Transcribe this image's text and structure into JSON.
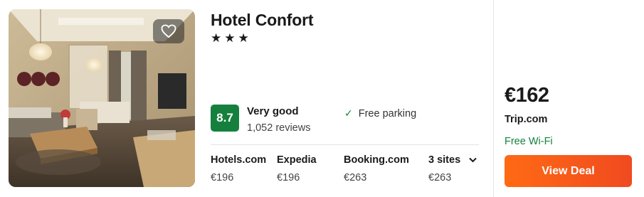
{
  "hotel": {
    "name": "Hotel Confort",
    "stars": "★★★",
    "rating": {
      "score": "8.7",
      "label": "Very good",
      "reviews": "1,052 reviews"
    },
    "amenity": "Free parking"
  },
  "sites": [
    {
      "name": "Hotels.com",
      "price": "€196"
    },
    {
      "name": "Expedia",
      "price": "€196"
    },
    {
      "name": "Booking.com",
      "price": "€263"
    },
    {
      "name": "3 sites",
      "price": "€263"
    }
  ],
  "deal": {
    "price": "€162",
    "provider": "Trip.com",
    "perk": "Free Wi-Fi",
    "button_label": "View Deal"
  },
  "icons": {
    "favorite": "heart-icon",
    "check": "check-icon",
    "expand": "chevron-down-icon"
  },
  "colors": {
    "rating_badge": "#15803d",
    "perk_text": "#15803d",
    "deal_button": "#f85a1a"
  }
}
